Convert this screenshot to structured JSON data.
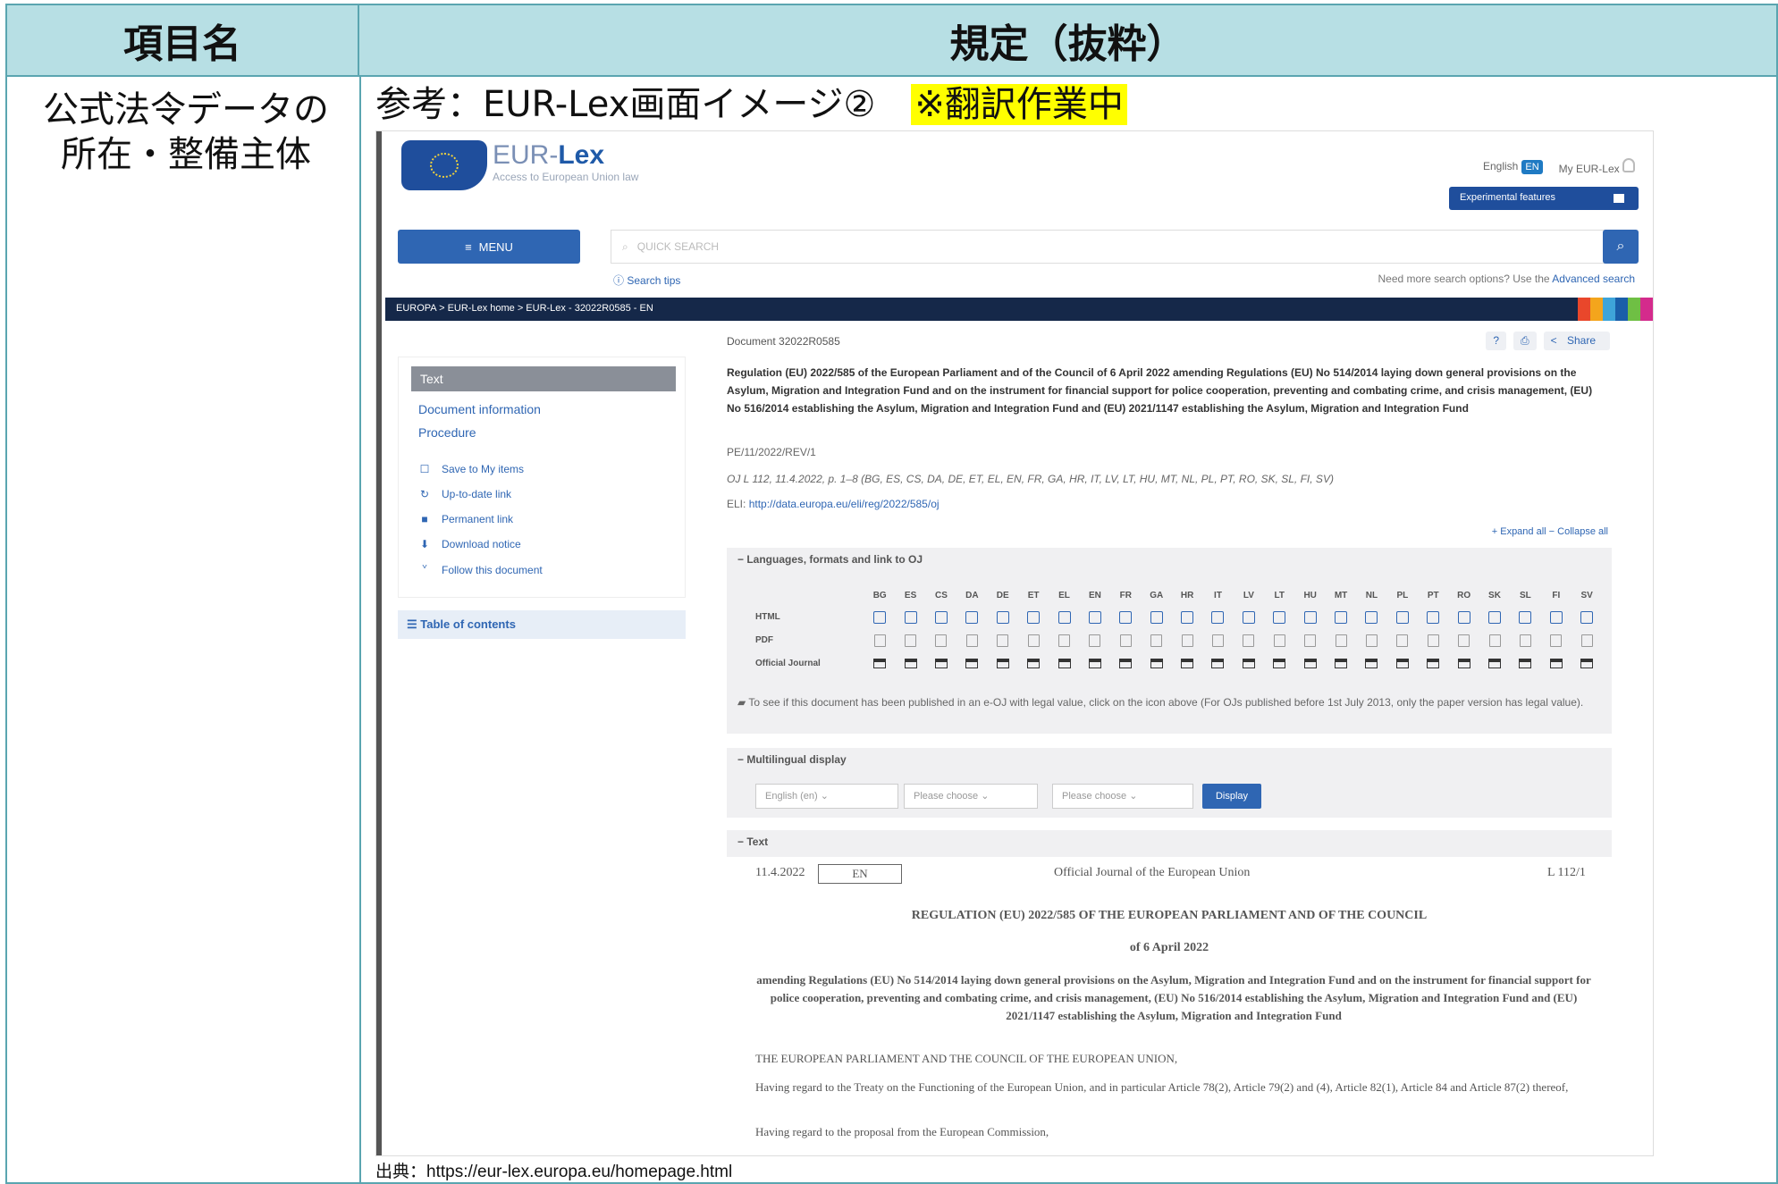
{
  "table": {
    "header_left": "項目名",
    "header_right": "規定（抜粋）",
    "row_label_line1": "公式法令データの",
    "row_label_line2": "所在・整備主体",
    "caption": "参考：EUR-Lex画面イメージ②",
    "caption_note": "※翻訳作業中",
    "source": "出典：https://eur-lex.europa.eu/homepage.html"
  },
  "eurlex": {
    "logo_text_a": "EUR-",
    "logo_text_b": "Lex",
    "logo_subtitle": "Access to European Union law",
    "lang_link": "English",
    "lang_badge": "EN",
    "my_eurlex": "My EUR-Lex",
    "experimental": "Experimental features",
    "menu_label": "MENU",
    "search_placeholder": "QUICK SEARCH",
    "search_tips": "Search tips",
    "more_options": "Need more search options? Use the",
    "advanced_search": "Advanced search",
    "breadcrumb": "EUROPA  >  EUR-Lex home  >  EUR-Lex - 32022R0585 - EN",
    "document_id": "Document 32022R0585",
    "share": "Share",
    "sidebar": {
      "active": "Text",
      "links": [
        "Document information",
        "Procedure"
      ],
      "tools": [
        "Save to My items",
        "Up-to-date link",
        "Permanent link",
        "Download notice",
        "Follow this document"
      ],
      "toc": "Table of contents"
    },
    "doc_title": "Regulation (EU) 2022/585 of the European Parliament and of the Council of 6 April 2022 amending Regulations (EU) No 514/2014 laying down general provisions on the Asylum, Migration and Integration Fund and on the instrument for financial support for police cooperation, preventing and combating crime, and crisis management, (EU) No 516/2014 establishing the Asylum, Migration and Integration Fund and (EU) 2021/1147 establishing the Asylum, Migration and Integration Fund",
    "doc_code": "PE/11/2022/REV/1",
    "oj_ref": "OJ L 112, 11.4.2022, p. 1–8 (BG, ES, CS, DA, DE, ET, EL, EN, FR, GA, HR, IT, LV, LT, HU, MT, NL, PL, PT, RO, SK, SL, FI, SV)",
    "eli_label": "ELI:",
    "eli_link": "http://data.europa.eu/eli/reg/2022/585/oj",
    "expand_collapse": "+ Expand all   − Collapse all",
    "languages_panel": "Languages, formats and link to OJ",
    "languages": [
      "BG",
      "ES",
      "CS",
      "DA",
      "DE",
      "ET",
      "EL",
      "EN",
      "FR",
      "GA",
      "HR",
      "IT",
      "LV",
      "LT",
      "HU",
      "MT",
      "NL",
      "PL",
      "PT",
      "RO",
      "SK",
      "SL",
      "FI",
      "SV"
    ],
    "row_html": "HTML",
    "row_pdf": "PDF",
    "row_oj": "Official Journal",
    "oj_note": "To see if this document has been published in an e-OJ with legal value, click on the icon above (For OJs published before 1st July 2013, only the paper version has legal value).",
    "multilingual_panel": "Multilingual display",
    "select1": "English (en)",
    "select2": "Please choose",
    "select3": "Please choose",
    "display_btn": "Display",
    "text_panel": "Text",
    "oj_date": "11.4.2022",
    "oj_lang": "EN",
    "oj_journal": "Official Journal of the European Union",
    "oj_page": "L 112/1",
    "reg_title": "REGULATION (EU) 2022/585 OF THE EUROPEAN PARLIAMENT AND OF THE COUNCIL",
    "reg_date": "of 6 April 2022",
    "reg_subject": "amending Regulations (EU) No 514/2014 laying down general provisions on the Asylum, Migration and Integration Fund and on the instrument for financial support for police cooperation, preventing and combating crime, and crisis management, (EU) No 516/2014 establishing the Asylum, Migration and Integration Fund and (EU) 2021/1147 establishing the Asylum, Migration and Integration Fund",
    "reg_para1": "THE EUROPEAN PARLIAMENT AND THE COUNCIL OF THE EUROPEAN UNION,",
    "reg_para2": "Having regard to the Treaty on the Functioning of the European Union, and in particular Article 78(2), Article 79(2) and (4), Article 82(1), Article 84 and Article 87(2) thereof,",
    "reg_para3": "Having regard to the proposal from the European Commission,"
  },
  "colors": {
    "header_bg": "#b7dfe4",
    "border": "#5aa5b0",
    "highlight": "#ffff00",
    "eurlex_blue": "#2f66b3",
    "navbar": "#152849"
  }
}
